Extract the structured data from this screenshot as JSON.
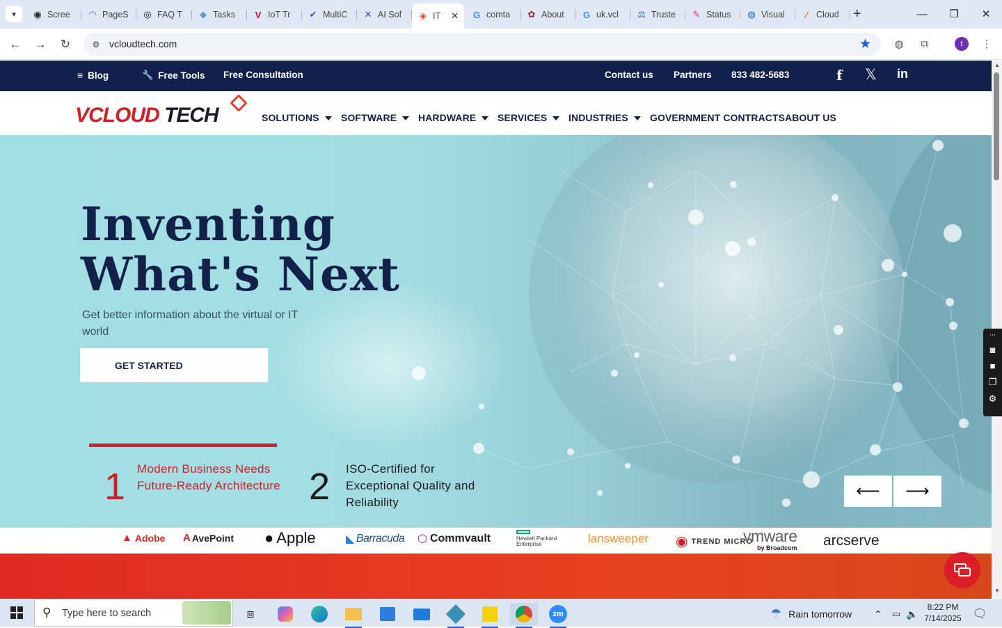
{
  "browser": {
    "tabs": [
      {
        "label": "Scree",
        "fav": "◉",
        "fav_color": "#222"
      },
      {
        "label": "PageS",
        "fav": "◠",
        "fav_color": "#3a6fd8"
      },
      {
        "label": "FAQ T",
        "fav": "◎",
        "fav_color": "#111"
      },
      {
        "label": "Tasks",
        "fav": "◆",
        "fav_color": "#5b9bb6"
      },
      {
        "label": "IoT Tr",
        "fav": "V",
        "fav_color": "#b3123a"
      },
      {
        "label": "MultiC",
        "fav": "✔",
        "fav_color": "#2f5fb3"
      },
      {
        "label": "AI Sof",
        "fav": "✕",
        "fav_color": "#3347b8"
      },
      {
        "label": "IT",
        "fav": "◈",
        "fav_color": "#e8402a"
      },
      {
        "label": "comta",
        "fav": "G",
        "fav_color": "#4285f4"
      },
      {
        "label": "About",
        "fav": "✿",
        "fav_color": "#a0243c"
      },
      {
        "label": "uk.vcl",
        "fav": "G",
        "fav_color": "#4285f4"
      },
      {
        "label": "Truste",
        "fav": "⚖",
        "fav_color": "#2d6ca8"
      },
      {
        "label": "Status",
        "fav": "✎",
        "fav_color": "#d4287d"
      },
      {
        "label": "Visual",
        "fav": "◍",
        "fav_color": "#1e64c8"
      },
      {
        "label": "Cloud",
        "fav": "⁄",
        "fav_color": "#e4572e"
      }
    ],
    "active_tab_index": 7,
    "url": "vcloudtech.com",
    "profile_initial": "t"
  },
  "site": {
    "topbar": {
      "blog": "Blog",
      "free_tools": "Free Tools",
      "free_consultation": "Free Consultation",
      "contact": "Contact us",
      "partners": "Partners",
      "phone": "833 482-5683"
    },
    "logo": {
      "v": "VCLOUD",
      "tech": " TECH"
    },
    "nav": [
      {
        "label": "SOLUTIONS",
        "dropdown": true
      },
      {
        "label": "SOFTWARE",
        "dropdown": true
      },
      {
        "label": "HARDWARE",
        "dropdown": true
      },
      {
        "label": "SERVICES",
        "dropdown": true
      },
      {
        "label": "INDUSTRIES",
        "dropdown": true
      },
      {
        "label": "GOVERNMENT CONTRACTS",
        "dropdown": false
      },
      {
        "label": "ABOUT US",
        "dropdown": false
      }
    ],
    "hero": {
      "title": "Inventing What's Next",
      "subtitle": "Get better information about the virtual or IT world",
      "cta": "GET STARTED",
      "features": [
        {
          "num": "1",
          "text": "Modern Business Needs Future-Ready Architecture",
          "color": "#d21f26"
        },
        {
          "num": "2",
          "text": "ISO-Certified for Exceptional Quality and Reliability",
          "color": "#1b1b1b"
        }
      ],
      "prev_arrow": "⟵",
      "next_arrow": "⟶"
    },
    "partners": [
      {
        "name": "Adobe",
        "color": "#e1251b"
      },
      {
        "name": "AvePoint",
        "color": "#222"
      },
      {
        "name": "Apple",
        "color": "#111"
      },
      {
        "name": "Barracuda",
        "color": "#1d4c8f"
      },
      {
        "name": "Commvault",
        "color": "#222"
      },
      {
        "name": "Hewlett Packard Enterprise",
        "color": "#333"
      },
      {
        "name": "lansweeper",
        "color": "#f29130"
      },
      {
        "name": "TREND MICRO",
        "color": "#333"
      },
      {
        "name": "vmware",
        "sub": "by Broadcom",
        "color": "#5e5e5e"
      },
      {
        "name": "arcserve",
        "color": "#222"
      }
    ]
  },
  "taskbar": {
    "search_placeholder": "Type here to search",
    "weather": "Rain tomorrow",
    "time": "8:22 PM",
    "date": "7/14/2025"
  },
  "colors": {
    "navy": "#12204d",
    "brand_red": "#d21f26",
    "hero_teal": "#a1dfe4"
  }
}
